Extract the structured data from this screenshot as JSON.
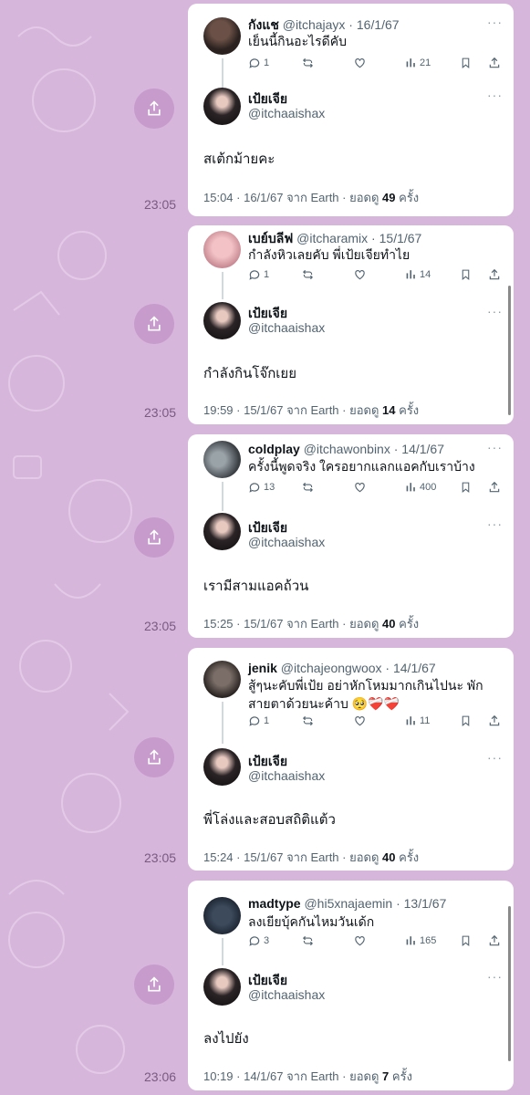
{
  "theme": {
    "accent": "#c79bcc",
    "wallpaper": "#d7b6dc",
    "card": "#ffffff"
  },
  "messages": [
    {
      "time": "23:05",
      "reply": {
        "name": "กังแช",
        "handle": "@itchajayx",
        "date": "16/1/67",
        "text": "เย็นนี้กินอะไรดีคับ",
        "replies": "1",
        "views": "21",
        "avatar": "avatar-reply-1"
      },
      "main": {
        "name": "เป้ยเจีย",
        "handle": "@itchaaishax",
        "text": "สเต้กม้ายคะ",
        "time": "15:04 · 16/1/67 จาก Earth · ยอดดู",
        "views": "49",
        "views_suffix": "ครั้ง"
      }
    },
    {
      "time": "23:05",
      "reply": {
        "name": "เบย์บลีฟ",
        "handle": "@itcharamix",
        "date": "15/1/67",
        "text": "กำลังหิวเลยคับ พี่เป้ยเจียทำไย",
        "replies": "1",
        "views": "14",
        "avatar": "avatar-reply-2"
      },
      "main": {
        "name": "เป้ยเจีย",
        "handle": "@itchaaishax",
        "text": "กำลังกินโจ๊กเยย",
        "time": "19:59 · 15/1/67 จาก Earth · ยอดดู",
        "views": "14",
        "views_suffix": "ครั้ง"
      }
    },
    {
      "time": "23:05",
      "reply": {
        "name": "coldplay",
        "handle": "@itchawonbinx",
        "date": "14/1/67",
        "text": "ครั้งนี้พูดจริง ใครอยากแลกแอคกับเราบ้าง",
        "replies": "13",
        "views": "400",
        "avatar": "avatar-reply-3"
      },
      "main": {
        "name": "เป้ยเจีย",
        "handle": "@itchaaishax",
        "text": "เรามีสามแอคถ้วน",
        "time": "15:25 · 15/1/67 จาก Earth · ยอดดู",
        "views": "40",
        "views_suffix": "ครั้ง"
      }
    },
    {
      "time": "23:05",
      "reply": {
        "name": "jenik",
        "handle": "@itchajeongwoox",
        "date": "14/1/67",
        "text": "สู้ๆนะคับพี่เป้ย อย่าหักโหมมากเกินไปนะ พักสายตาด้วยนะค้าบ 🥺❤️‍🩹❤️‍🩹",
        "replies": "1",
        "views": "11",
        "avatar": "avatar-reply-4"
      },
      "main": {
        "name": "เป้ยเจีย",
        "handle": "@itchaaishax",
        "text": "พี่โล่งและสอบสถิติแต้ว",
        "time": "15:24 · 15/1/67 จาก Earth · ยอดดู",
        "views": "40",
        "views_suffix": "ครั้ง"
      }
    },
    {
      "time": "23:06",
      "reply": {
        "name": "madtype",
        "handle": "@hi5xnajaemin",
        "date": "13/1/67",
        "text": "ลงเยียบุ้คกันไหมวันเด้ก",
        "replies": "3",
        "views": "165",
        "avatar": "avatar-reply-5"
      },
      "main": {
        "name": "เป้ยเจีย",
        "handle": "@itchaaishax",
        "text": "ลงไปยัง",
        "time": "10:19 · 14/1/67 จาก Earth · ยอดดู",
        "views": "7",
        "views_suffix": "ครั้ง"
      }
    }
  ]
}
